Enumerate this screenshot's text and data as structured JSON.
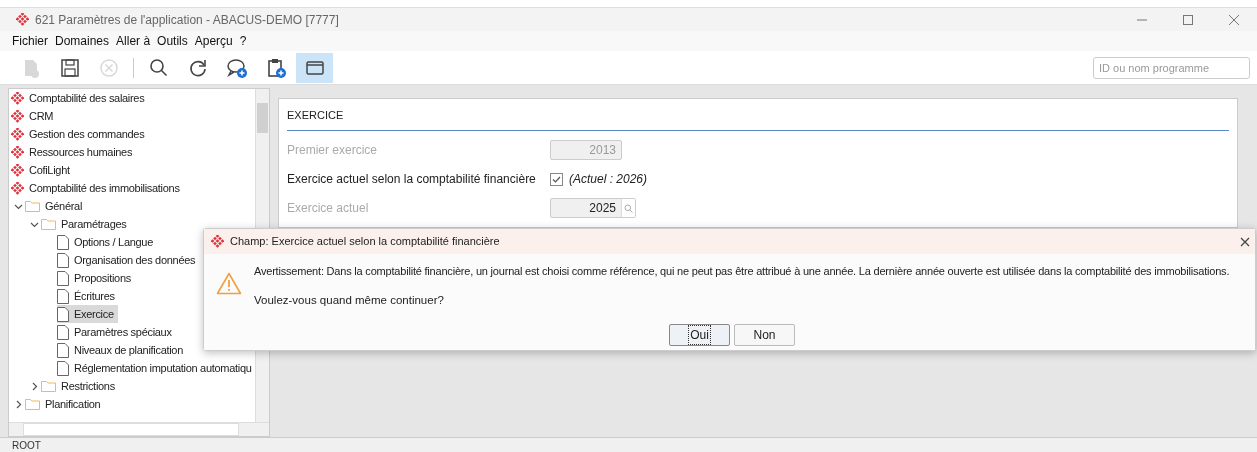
{
  "window": {
    "title": "621 Paramètres de l'application - ABACUS-DEMO [7777]"
  },
  "menu": [
    "Fichier",
    "Domaines",
    "Aller à",
    "Outils",
    "Aperçu",
    "?"
  ],
  "toolbar": [
    {
      "kind": "new",
      "disabled": true,
      "selected": false
    },
    {
      "kind": "save",
      "disabled": false,
      "selected": false
    },
    {
      "kind": "cancel",
      "disabled": true,
      "selected": false
    },
    {
      "kind": "search",
      "disabled": false,
      "selected": false
    },
    {
      "kind": "refresh",
      "disabled": false,
      "selected": false
    },
    {
      "kind": "comment",
      "disabled": false,
      "selected": false
    },
    {
      "kind": "clipboard",
      "disabled": false,
      "selected": false
    },
    {
      "kind": "window",
      "disabled": false,
      "selected": true
    }
  ],
  "search": {
    "placeholder": "ID ou nom programme"
  },
  "tree": [
    {
      "kind": "module",
      "label": "Comptabilité des salaires",
      "selected": false
    },
    {
      "kind": "module",
      "label": "CRM",
      "selected": false
    },
    {
      "kind": "module",
      "label": "Gestion des commandes",
      "selected": false
    },
    {
      "kind": "module",
      "label": "Ressources humaines",
      "selected": false
    },
    {
      "kind": "module",
      "label": "CofiLight",
      "selected": false
    },
    {
      "kind": "module",
      "label": "Comptabilité des immobilisations",
      "selected": false
    },
    {
      "kind": "folder",
      "label": "Général",
      "selected": false,
      "expanded": true,
      "children": [
        {
          "kind": "folder",
          "label": "Paramétrages",
          "selected": false,
          "expanded": true,
          "children": [
            {
              "kind": "doc",
              "label": "Options / Langue",
              "selected": false
            },
            {
              "kind": "doc",
              "label": "Organisation des données",
              "selected": false
            },
            {
              "kind": "doc",
              "label": "Propositions",
              "selected": false
            },
            {
              "kind": "doc",
              "label": "Écritures",
              "selected": false
            },
            {
              "kind": "doc",
              "label": "Exercice",
              "selected": true
            },
            {
              "kind": "doc",
              "label": "Paramètres spéciaux",
              "selected": false
            },
            {
              "kind": "doc",
              "label": "Niveaux de planification",
              "selected": false
            },
            {
              "kind": "doc",
              "label": "Réglementation imputation automatiqu",
              "selected": false
            }
          ]
        },
        {
          "kind": "folder",
          "label": "Restrictions",
          "selected": false,
          "expanded": false
        }
      ]
    },
    {
      "kind": "folder",
      "label": "Planification",
      "selected": false,
      "expanded": false
    }
  ],
  "form": {
    "title": "EXERCICE",
    "rows": [
      {
        "kind": "field",
        "label": "Premier exercice",
        "disabled": true,
        "value": "2013"
      },
      {
        "kind": "checkbox",
        "label": "Exercice actuel selon la comptabilité financière",
        "disabled": false,
        "checked": true,
        "note": "(Actuel : 2026)"
      },
      {
        "kind": "lookup",
        "label": "Exercice actuel",
        "disabled": true,
        "value": "2025"
      }
    ]
  },
  "dialog": {
    "title": "Champ: Exercice actuel selon la comptabilité financière",
    "message": "Avertissement: Dans la comptabilité financière, un journal est choisi comme référence, qui ne peut pas être attribué à une année. La dernière année ouverte est utilisée dans la comptabilité des immobilisations.",
    "question": "Voulez-vous quand même continuer?",
    "buttons": [
      {
        "label": "Oui",
        "focused": true
      },
      {
        "label": "Non",
        "focused": false
      }
    ]
  },
  "status_bar": "ROOT"
}
